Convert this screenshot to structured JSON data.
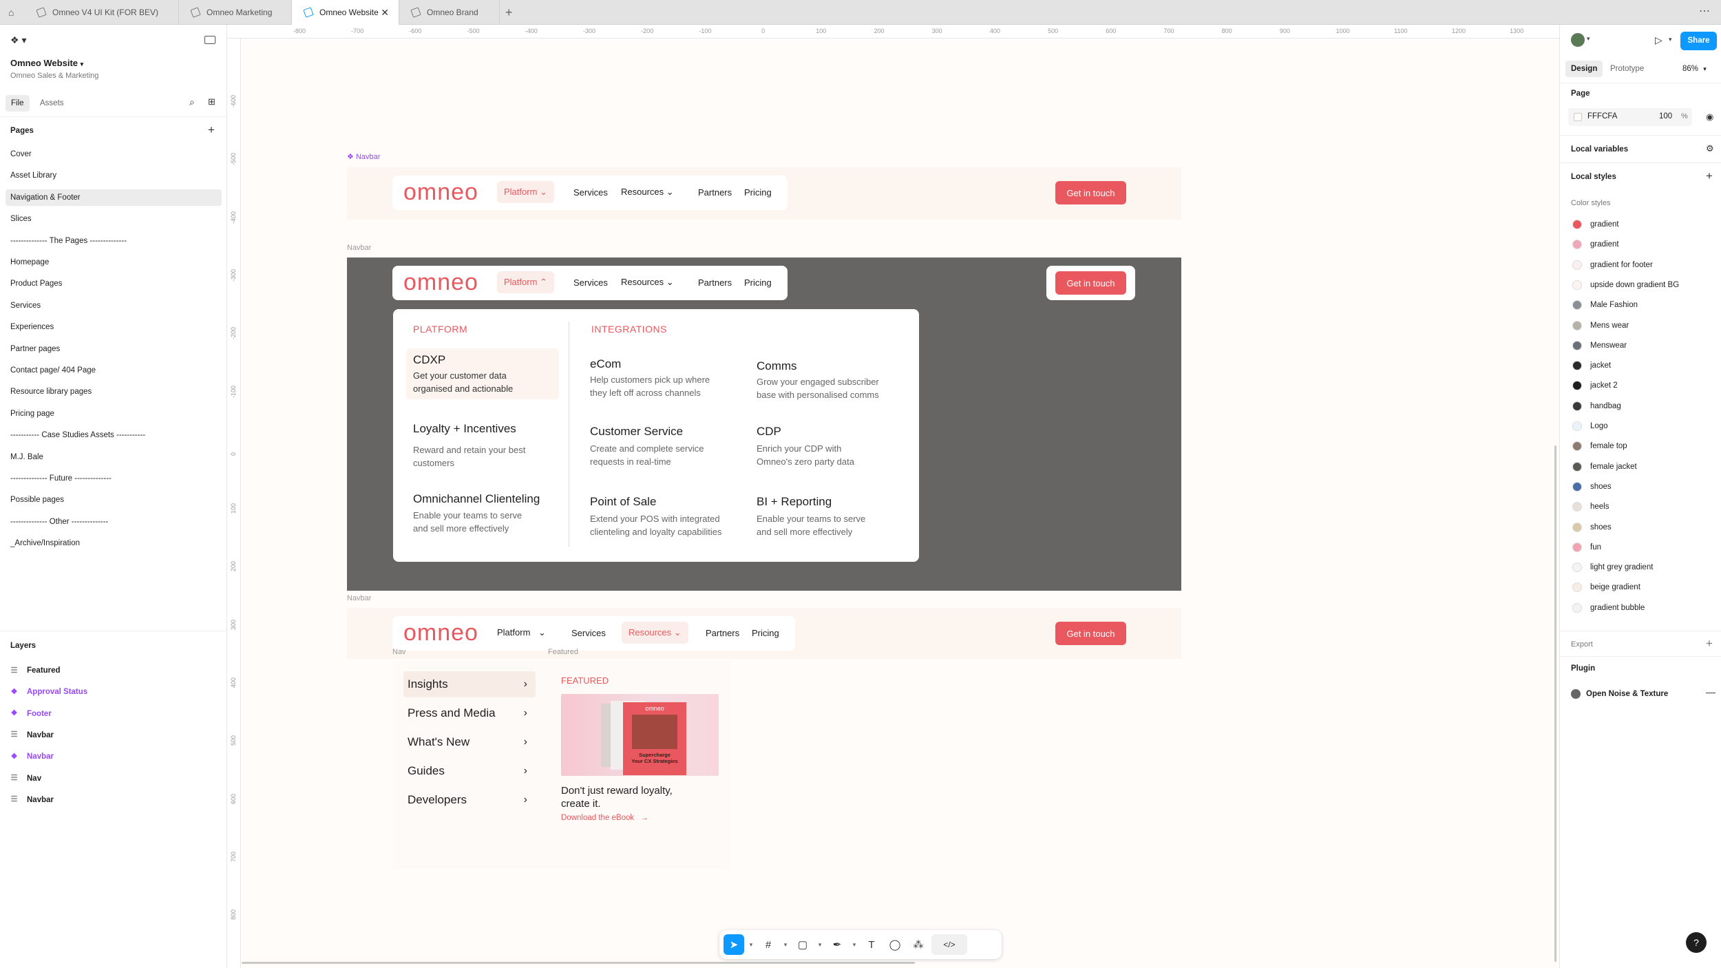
{
  "tabs": [
    {
      "label": "Omneo V4 UI Kit (FOR BEV)"
    },
    {
      "label": "Omneo Marketing"
    },
    {
      "label": "Omneo Website"
    },
    {
      "label": "Omneo Brand"
    }
  ],
  "file": {
    "name": "Omneo Website",
    "team": "Omneo Sales & Marketing"
  },
  "left_tabs": {
    "file": "File",
    "assets": "Assets"
  },
  "pages_title": "Pages",
  "pages": [
    "Cover",
    "Asset Library",
    "Navigation & Footer",
    "Slices",
    "-------------- The Pages --------------",
    "Homepage",
    "Product Pages",
    "Services",
    "Experiences",
    "Partner pages",
    "Contact page/ 404 Page",
    "Resource library pages",
    "Pricing page",
    "----------- Case Studies Assets -----------",
    "M.J. Bale",
    "-------------- Future --------------",
    "Possible pages",
    "-------------- Other --------------",
    "_Archive/Inspiration"
  ],
  "layers_title": "Layers",
  "layers": [
    {
      "label": "Featured",
      "kind": "frame"
    },
    {
      "label": "Approval Status",
      "kind": "component"
    },
    {
      "label": "Footer",
      "kind": "component"
    },
    {
      "label": "Navbar",
      "kind": "frame"
    },
    {
      "label": "Navbar",
      "kind": "component"
    },
    {
      "label": "Nav",
      "kind": "frame"
    },
    {
      "label": "Navbar",
      "kind": "frame"
    }
  ],
  "ruler_top": [
    "-800",
    "-700",
    "-600",
    "-500",
    "-400",
    "-300",
    "-200",
    "-100",
    "0",
    "100",
    "200",
    "300",
    "400",
    "500",
    "600",
    "700",
    "800",
    "900",
    "1000",
    "1100",
    "1200",
    "1300"
  ],
  "ruler_left": [
    "-600",
    "-500",
    "-400",
    "-300",
    "-200",
    "-100",
    "0",
    "100",
    "200",
    "300",
    "400",
    "500",
    "600",
    "700",
    "800"
  ],
  "canvas": {
    "labels": {
      "navbar1": "Navbar",
      "navbar2": "Navbar",
      "navbar3": "Navbar",
      "nav": "Nav",
      "featured": "Featured"
    },
    "logo": "omneo",
    "nav": {
      "platform": "Platform",
      "services": "Services",
      "resources": "Resources",
      "partners": "Partners",
      "pricing": "Pricing",
      "cta": "Get in touch"
    },
    "mega": {
      "platform_heading": "PLATFORM",
      "integrations_heading": "INTEGRATIONS",
      "platform_items": [
        {
          "title": "CDXP",
          "desc1": "Get your customer data",
          "desc2": "organised and actionable"
        },
        {
          "title": "Loyalty + Incentives",
          "desc1": "Reward and retain your best",
          "desc2": "customers"
        },
        {
          "title": "Omnichannel Clienteling",
          "desc1": "Enable your teams to serve",
          "desc2": "and sell more effectively"
        }
      ],
      "integration_items": [
        {
          "title": "eCom",
          "desc1": "Help customers pick up where",
          "desc2": "they left off across channels"
        },
        {
          "title": "Comms",
          "desc1": "Grow your engaged subscriber",
          "desc2": "base with personalised comms"
        },
        {
          "title": "Customer Service",
          "desc1": "Create and complete service",
          "desc2": "requests in real-time"
        },
        {
          "title": "CDP",
          "desc1": "Enrich your CDP with",
          "desc2": "Omneo's zero party data"
        },
        {
          "title": "Point of Sale",
          "desc1": "Extend your POS with integrated",
          "desc2": "clienteling and loyalty capabilities"
        },
        {
          "title": "BI + Reporting",
          "desc1": "Enable your teams to serve",
          "desc2": "and sell more effectively"
        }
      ]
    },
    "resources_menu": [
      "Insights",
      "Press and Media",
      "What's New",
      "Guides",
      "Developers"
    ],
    "featured": {
      "heading": "FEATURED",
      "book_brand": "omneo",
      "book_title1": "Supercharge",
      "book_title2": "Your CX Strategies",
      "title1": "Don't just reward loyalty,",
      "title2": "create it.",
      "link": "Download the eBook"
    }
  },
  "right": {
    "share": "Share",
    "tabs": {
      "design": "Design",
      "prototype": "Prototype"
    },
    "zoom": "86%",
    "page_title": "Page",
    "page_color": "FFFCFA",
    "page_opacity": "100",
    "page_opacity_unit": "%",
    "local_variables": "Local variables",
    "local_styles": "Local styles",
    "color_styles_title": "Color styles",
    "color_styles": [
      {
        "name": "gradient",
        "color": "#e8585e"
      },
      {
        "name": "gradient",
        "color": "#f0a8b8"
      },
      {
        "name": "gradient for footer",
        "color": "#fbeff0"
      },
      {
        "name": "upside down gradient BG",
        "color": "#fdf4f2"
      },
      {
        "name": "Male Fashion",
        "color": "#8a8f96"
      },
      {
        "name": "Mens wear",
        "color": "#b8b1a6"
      },
      {
        "name": "Menswear",
        "color": "#6b6f77"
      },
      {
        "name": "jacket",
        "color": "#2a2a2a"
      },
      {
        "name": "jacket 2",
        "color": "#1f1f1f"
      },
      {
        "name": "handbag",
        "color": "#3a3a3a"
      },
      {
        "name": "Logo",
        "color": "#e8f4fa"
      },
      {
        "name": "female top",
        "color": "#8d7a72"
      },
      {
        "name": "female jacket",
        "color": "#5c5a55"
      },
      {
        "name": "shoes",
        "color": "#4a6fa5"
      },
      {
        "name": "heels",
        "color": "#e8e0d8"
      },
      {
        "name": "shoes",
        "color": "#d9c9a8"
      },
      {
        "name": "fun",
        "color": "#f2a3b0"
      },
      {
        "name": "light grey gradient",
        "color": "#f4f4f4"
      },
      {
        "name": "beige gradient",
        "color": "#f7ede4"
      },
      {
        "name": "gradient bubble",
        "color": "#f6f2f4"
      }
    ],
    "export": "Export",
    "plugin_title": "Plugin",
    "plugin_name": "Open Noise & Texture"
  },
  "colors": {
    "accent": "#e8585e",
    "figma_blue": "#0d99ff",
    "component_purple": "#9747ff",
    "canvas_bg": "#fffcfa",
    "overlay": "#666563"
  }
}
